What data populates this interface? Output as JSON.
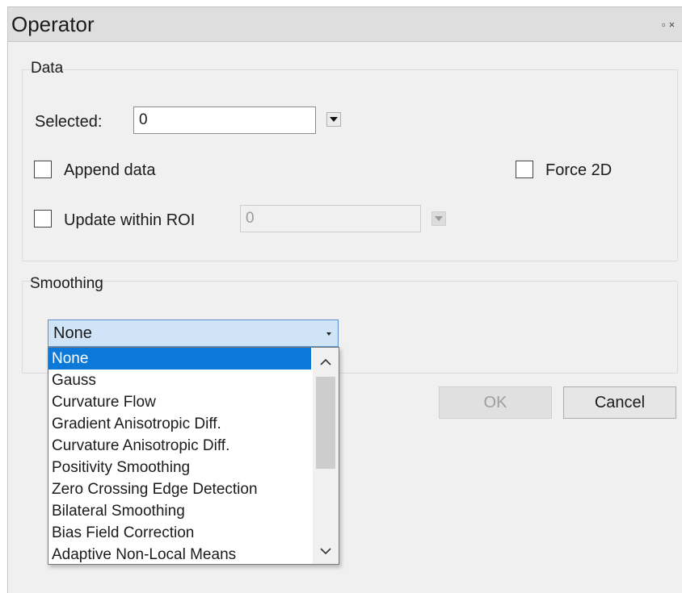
{
  "window": {
    "title": "Operator",
    "icons": [
      "restore-icon",
      "close-icon"
    ],
    "restore_glyph": "▫",
    "close_glyph": "×"
  },
  "data_group": {
    "label": "Data",
    "selected_label": "Selected:",
    "selected_value": "0",
    "append_label": "Append data",
    "append_checked": false,
    "force2d_label": "Force 2D",
    "force2d_checked": false,
    "update_roi_label": "Update within ROI",
    "update_roi_checked": false,
    "roi_value": "0"
  },
  "smoothing_group": {
    "label": "Smoothing",
    "selected": "None",
    "options": [
      "None",
      "Gauss",
      "Curvature Flow",
      "Gradient Anisotropic Diff.",
      "Curvature Anisotropic Diff.",
      "Positivity Smoothing",
      "Zero Crossing Edge Detection",
      "Bilateral Smoothing",
      "Bias Field Correction",
      "Adaptive Non-Local Means"
    ],
    "scroll_up": "^",
    "scroll_down": "v"
  },
  "buttons": {
    "ok": "OK",
    "cancel": "Cancel",
    "ok_enabled": false
  },
  "colors": {
    "selection": "#0c78d8",
    "combo_highlight": "#cfe4f7",
    "panel_bg": "#f0f0f0"
  }
}
